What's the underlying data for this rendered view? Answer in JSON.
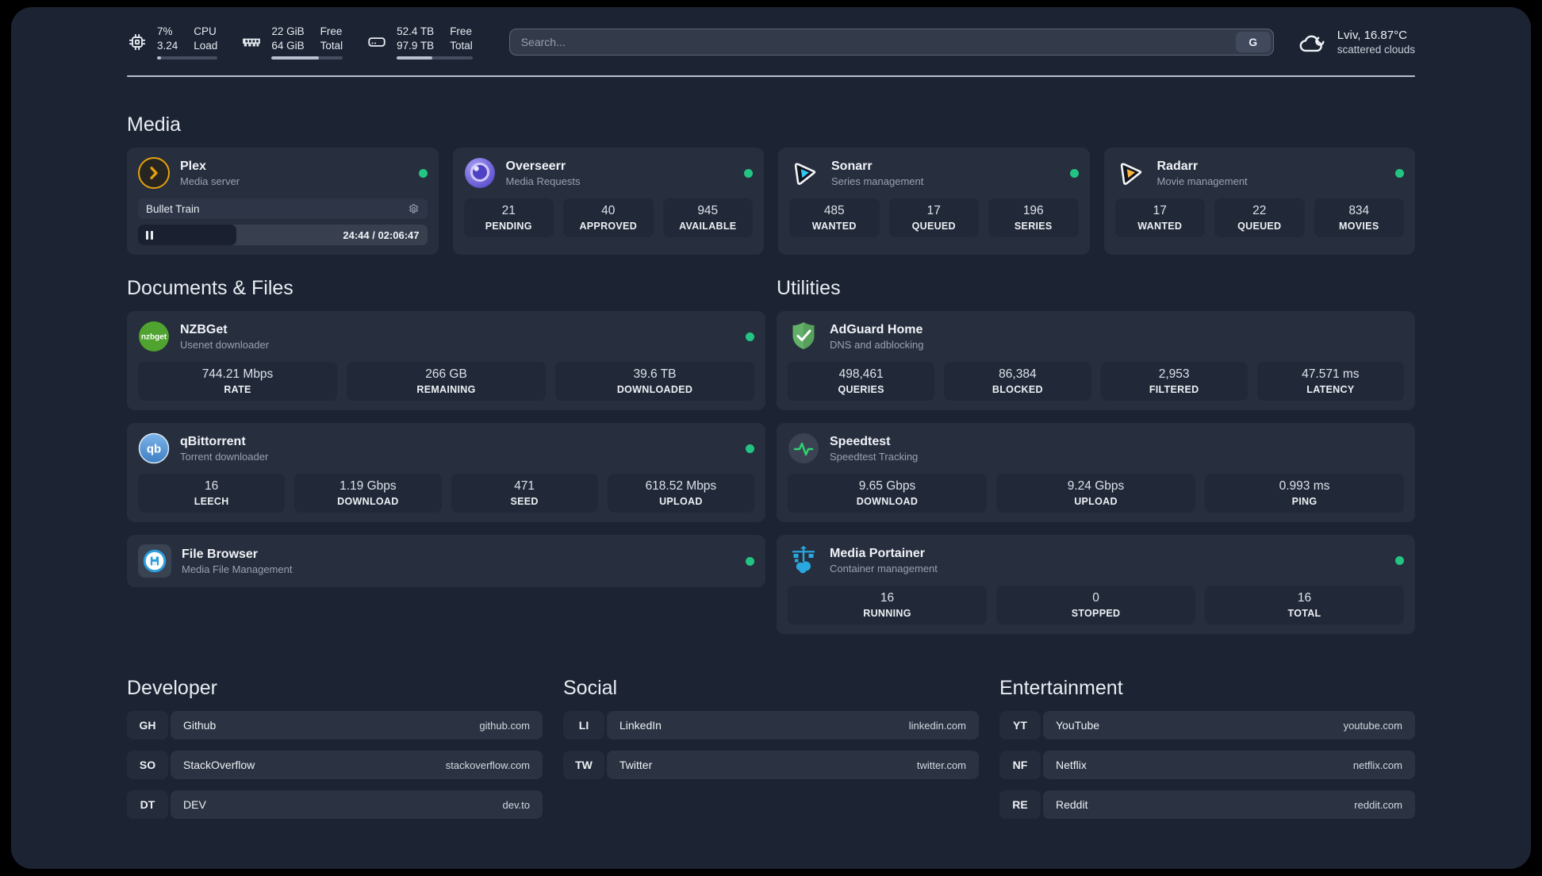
{
  "header": {
    "system": {
      "cpu": {
        "value1": "7%",
        "value2": "3.24",
        "label1": "CPU",
        "label2": "Load",
        "progress": 7
      },
      "memory": {
        "value1": "22 GiB",
        "value2": "64 GiB",
        "label1": "Free",
        "label2": "Total",
        "progress": 66
      },
      "disk": {
        "value1": "52.4 TB",
        "value2": "97.9 TB",
        "label1": "Free",
        "label2": "Total",
        "progress": 47
      }
    },
    "search": {
      "placeholder": "Search...",
      "provider": "G"
    },
    "weather": {
      "location": "Lviv, 16.87°C",
      "condition": "scattered clouds"
    }
  },
  "sections": {
    "media": {
      "title": "Media",
      "cards": [
        {
          "title": "Plex",
          "subtitle": "Media server",
          "player": {
            "track": "Bullet Train",
            "time": "24:44 / 02:06:47",
            "progress": 34
          }
        },
        {
          "title": "Overseerr",
          "subtitle": "Media Requests",
          "stats": [
            {
              "value": "21",
              "label": "PENDING"
            },
            {
              "value": "40",
              "label": "APPROVED"
            },
            {
              "value": "945",
              "label": "AVAILABLE"
            }
          ]
        },
        {
          "title": "Sonarr",
          "subtitle": "Series management",
          "stats": [
            {
              "value": "485",
              "label": "WANTED"
            },
            {
              "value": "17",
              "label": "QUEUED"
            },
            {
              "value": "196",
              "label": "SERIES"
            }
          ]
        },
        {
          "title": "Radarr",
          "subtitle": "Movie management",
          "stats": [
            {
              "value": "17",
              "label": "WANTED"
            },
            {
              "value": "22",
              "label": "QUEUED"
            },
            {
              "value": "834",
              "label": "MOVIES"
            }
          ]
        }
      ]
    },
    "documents": {
      "title": "Documents & Files",
      "cards": [
        {
          "title": "NZBGet",
          "subtitle": "Usenet downloader",
          "stats": [
            {
              "value": "744.21 Mbps",
              "label": "RATE"
            },
            {
              "value": "266 GB",
              "label": "REMAINING"
            },
            {
              "value": "39.6 TB",
              "label": "DOWNLOADED"
            }
          ]
        },
        {
          "title": "qBittorrent",
          "subtitle": "Torrent downloader",
          "stats": [
            {
              "value": "16",
              "label": "LEECH"
            },
            {
              "value": "1.19 Gbps",
              "label": "DOWNLOAD"
            },
            {
              "value": "471",
              "label": "SEED"
            },
            {
              "value": "618.52 Mbps",
              "label": "UPLOAD"
            }
          ]
        },
        {
          "title": "File Browser",
          "subtitle": "Media File Management",
          "stats": []
        }
      ]
    },
    "utilities": {
      "title": "Utilities",
      "cards": [
        {
          "title": "AdGuard Home",
          "subtitle": "DNS and adblocking",
          "stats": [
            {
              "value": "498,461",
              "label": "QUERIES"
            },
            {
              "value": "86,384",
              "label": "BLOCKED"
            },
            {
              "value": "2,953",
              "label": "FILTERED"
            },
            {
              "value": "47.571 ms",
              "label": "LATENCY"
            }
          ]
        },
        {
          "title": "Speedtest",
          "subtitle": "Speedtest Tracking",
          "stats": [
            {
              "value": "9.65 Gbps",
              "label": "DOWNLOAD"
            },
            {
              "value": "9.24 Gbps",
              "label": "UPLOAD"
            },
            {
              "value": "0.993 ms",
              "label": "PING"
            }
          ]
        },
        {
          "title": "Media Portainer",
          "subtitle": "Container management",
          "stats": [
            {
              "value": "16",
              "label": "RUNNING"
            },
            {
              "value": "0",
              "label": "STOPPED"
            },
            {
              "value": "16",
              "label": "TOTAL"
            }
          ]
        }
      ]
    },
    "bookmarks": [
      {
        "title": "Developer",
        "items": [
          {
            "abbr": "GH",
            "name": "Github",
            "url": "github.com"
          },
          {
            "abbr": "SO",
            "name": "StackOverflow",
            "url": "stackoverflow.com"
          },
          {
            "abbr": "DT",
            "name": "DEV",
            "url": "dev.to"
          }
        ]
      },
      {
        "title": "Social",
        "items": [
          {
            "abbr": "LI",
            "name": "LinkedIn",
            "url": "linkedin.com"
          },
          {
            "abbr": "TW",
            "name": "Twitter",
            "url": "twitter.com"
          }
        ]
      },
      {
        "title": "Entertainment",
        "items": [
          {
            "abbr": "YT",
            "name": "YouTube",
            "url": "youtube.com"
          },
          {
            "abbr": "NF",
            "name": "Netflix",
            "url": "netflix.com"
          },
          {
            "abbr": "RE",
            "name": "Reddit",
            "url": "reddit.com"
          }
        ]
      }
    ]
  },
  "icon_labels": {
    "nzbget": "nzbget",
    "qbittorrent": "qb"
  },
  "colors": {
    "status_online": "#23c483",
    "plex_gold": "#e5a00d",
    "sonarr_cyan": "#35c5f4",
    "radarr_amber": "#ffb53b",
    "adguard_green": "#63b168",
    "portainer_blue": "#29a8e0",
    "speedtest_pulse": "#2fd573",
    "nzbget_green": "#4fa32e",
    "qbittorrent_blue": "#3d7fc4",
    "overseerr_purple": "#5346c9",
    "filebrowser_blue": "#2d9cdb"
  }
}
